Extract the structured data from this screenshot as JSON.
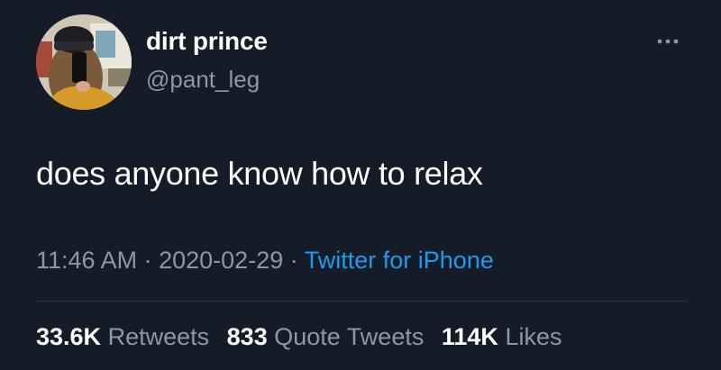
{
  "user": {
    "display_name": "dirt prince",
    "handle": "@pant_leg"
  },
  "tweet": {
    "text": "does anyone know how to relax",
    "time": "11:46 AM",
    "separator": "·",
    "date": "2020-02-29",
    "source": "Twitter for iPhone"
  },
  "stats": {
    "retweets_count": "33.6K",
    "retweets_label": "Retweets",
    "quotes_count": "833",
    "quotes_label": "Quote Tweets",
    "likes_count": "114K",
    "likes_label": "Likes"
  },
  "icons": {
    "more": "more-options-icon"
  },
  "colors": {
    "background": "#151c28",
    "text_primary": "#ffffff",
    "text_secondary": "#8b98a5",
    "accent": "#1d9bf0"
  }
}
